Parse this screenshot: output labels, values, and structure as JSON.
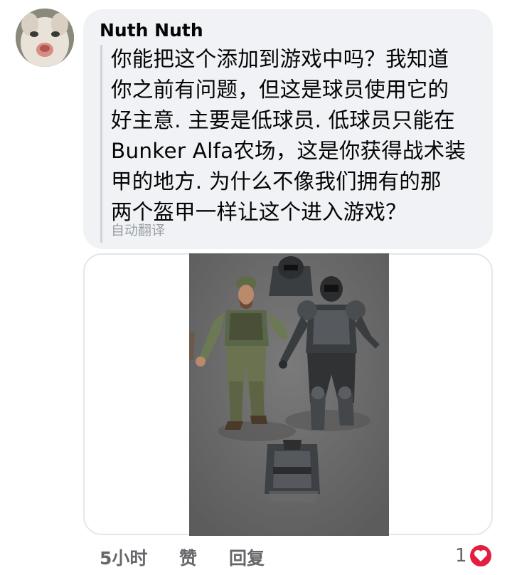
{
  "comment": {
    "author": "Nuth Nuth",
    "text": "你能把这个添加到游戏中吗？我知道\n你之前有问题，但这是球员使用它的\n好主意. 主要是低球员. 低球员只能在\nBunker Alfa农场，这是你获得战术装\n甲的地方. 为什么不像我们拥有的那\n两个盔甲一样让这个进入游戏？",
    "translation_label": "自动翻译"
  },
  "footer": {
    "time": "5小时",
    "like": "赞",
    "reply": "回复",
    "reaction_count": "1"
  },
  "icons": {
    "reaction": "heart-icon",
    "avatar": "cat-avatar"
  },
  "colors": {
    "bubble": "#f0f2f5",
    "meta_text": "#65676b",
    "heart": "#e41e3f"
  }
}
